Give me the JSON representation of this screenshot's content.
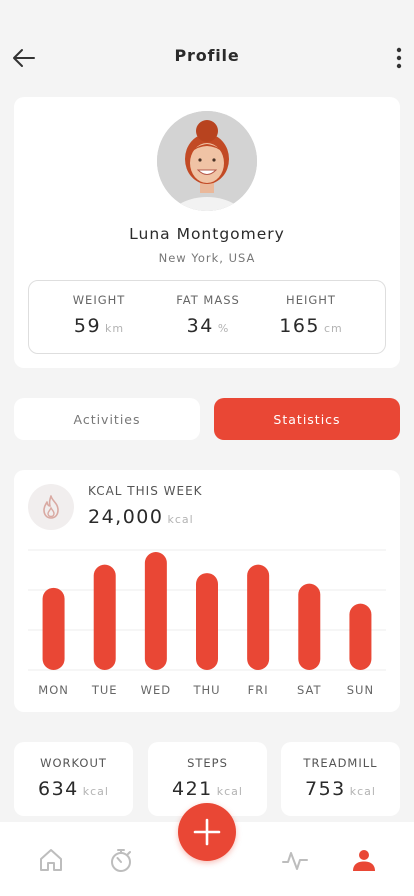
{
  "header": {
    "title": "Profile",
    "back_icon": "arrow-left-icon",
    "more_icon": "more-vertical-icon"
  },
  "profile": {
    "name": "Luna Montgomery",
    "location": "New York, USA",
    "metrics": [
      {
        "label": "WEIGHT",
        "value": "59",
        "unit": "km"
      },
      {
        "label": "FAT MASS",
        "value": "34",
        "unit": "%"
      },
      {
        "label": "HEIGHT",
        "value": "165",
        "unit": "cm"
      }
    ]
  },
  "tabs": [
    {
      "label": "Activities",
      "active": false
    },
    {
      "label": "Statistics",
      "active": true
    }
  ],
  "kcal": {
    "title": "KCAL THIS WEEK",
    "value": "24,000",
    "unit": "kcal",
    "icon": "flame-icon"
  },
  "chart_data": {
    "type": "bar",
    "categories": [
      "MON",
      "TUE",
      "WED",
      "THU",
      "FRI",
      "SAT",
      "SUN"
    ],
    "values": [
      78,
      100,
      112,
      92,
      100,
      82,
      63
    ],
    "grid": true
  },
  "summary": [
    {
      "label": "WORKOUT",
      "value": "634",
      "unit": "kcal"
    },
    {
      "label": "STEPS",
      "value": "421",
      "unit": "kcal"
    },
    {
      "label": "TREADMILL",
      "value": "753",
      "unit": "kcal"
    }
  ],
  "nav": {
    "items": [
      "home-icon",
      "stopwatch-icon",
      "activity-icon",
      "profile-icon"
    ],
    "fab_icon": "plus-icon",
    "active": "profile-icon"
  },
  "colors": {
    "accent": "#e94735",
    "background": "#f4f4f4",
    "card": "#ffffff"
  }
}
